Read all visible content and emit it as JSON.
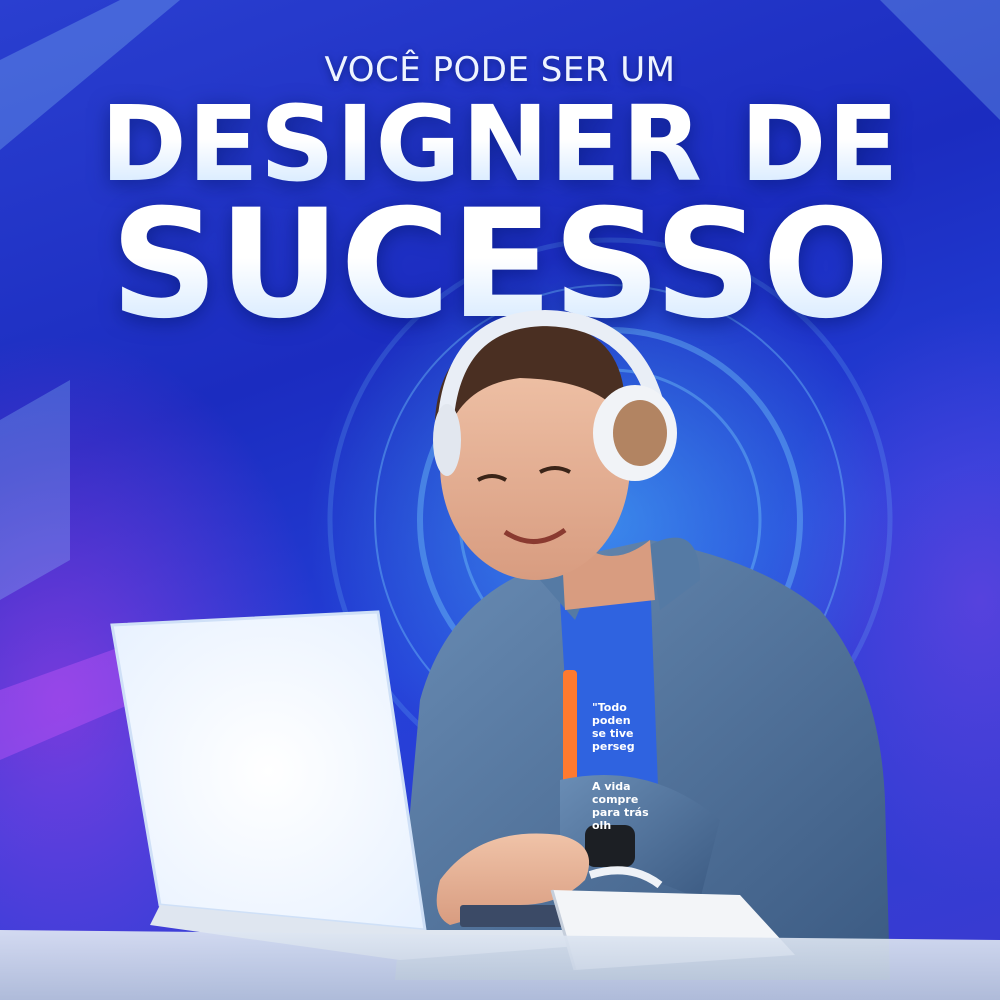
{
  "headline": {
    "kicker": "VOCÊ PODE SER UM",
    "line1": "DESIGNER DE",
    "line2": "SUCESSO"
  },
  "tshirt_text": {
    "block1": "\"Todo\npoden\nse tive\nperseg",
    "block2": "A vida\ncompre\npara trás\nolh"
  },
  "icons": {
    "headphones": "headphones-icon",
    "laptop": "laptop-icon",
    "wristwatch": "watch-icon",
    "notebook": "notebook-icon"
  },
  "colors": {
    "background_blue": "#1b2cc0",
    "glow_cyan": "#50c8ff",
    "glow_purple": "#be3ce6",
    "headline_white": "#ffffff",
    "denim": "#4a6c95",
    "tshirt_blue": "#2f63e0"
  }
}
